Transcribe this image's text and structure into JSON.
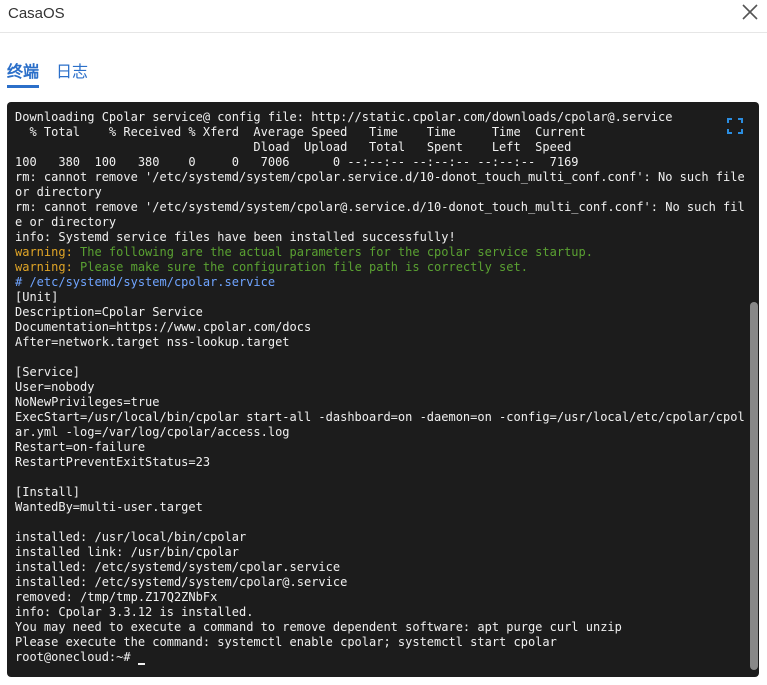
{
  "app": {
    "title": "CasaOS"
  },
  "tabs": [
    {
      "label": "终端"
    },
    {
      "label": "日志"
    }
  ],
  "terminal": {
    "lines": [
      {
        "text": "Downloading Cpolar service@ config file: http://static.cpolar.com/downloads/cpolar@.service"
      },
      {
        "text": "  % Total    % Received % Xferd  Average Speed   Time    Time     Time  Current"
      },
      {
        "text": "                                 Dload  Upload   Total   Spent    Left  Speed"
      },
      {
        "text": "100   380  100   380    0     0   7006      0 --:--:-- --:--:-- --:--:--  7169"
      },
      {
        "text": "rm: cannot remove '/etc/systemd/system/cpolar.service.d/10-donot_touch_multi_conf.conf': No such file or directory"
      },
      {
        "text": "rm: cannot remove '/etc/systemd/system/cpolar@.service.d/10-donot_touch_multi_conf.conf': No such file or directory"
      },
      {
        "text": "info: Systemd service files have been installed successfully!"
      },
      {
        "type": "warning",
        "keyword": "warning:",
        "text": "The following are the actual parameters for the cpolar service startup."
      },
      {
        "type": "warning",
        "keyword": "warning:",
        "text": "Please make sure the configuration file path is correctly set."
      },
      {
        "type": "path",
        "text": "# /etc/systemd/system/cpolar.service"
      },
      {
        "text": "[Unit]"
      },
      {
        "text": "Description=Cpolar Service"
      },
      {
        "text": "Documentation=https://www.cpolar.com/docs"
      },
      {
        "text": "After=network.target nss-lookup.target"
      },
      {
        "text": ""
      },
      {
        "text": "[Service]"
      },
      {
        "text": "User=nobody"
      },
      {
        "text": "NoNewPrivileges=true"
      },
      {
        "text": "ExecStart=/usr/local/bin/cpolar start-all -dashboard=on -daemon=on -config=/usr/local/etc/cpolar/cpolar.yml -log=/var/log/cpolar/access.log"
      },
      {
        "text": "Restart=on-failure"
      },
      {
        "text": "RestartPreventExitStatus=23"
      },
      {
        "text": ""
      },
      {
        "text": "[Install]"
      },
      {
        "text": "WantedBy=multi-user.target"
      },
      {
        "text": ""
      },
      {
        "text": "installed: /usr/local/bin/cpolar"
      },
      {
        "text": "installed link: /usr/bin/cpolar"
      },
      {
        "text": "installed: /etc/systemd/system/cpolar.service"
      },
      {
        "text": "installed: /etc/systemd/system/cpolar@.service"
      },
      {
        "text": "removed: /tmp/tmp.Z17Q2ZNbFx"
      },
      {
        "text": "info: Cpolar 3.3.12 is installed."
      },
      {
        "text": "You may need to execute a command to remove dependent software: apt purge curl unzip"
      },
      {
        "text": "Please execute the command: systemctl enable cpolar; systemctl start cpolar"
      }
    ],
    "prompt": "root@onecloud:~# "
  },
  "colors": {
    "accent": "#2b6fc9",
    "terminal_bg": "#1c1c1c",
    "warning": "#e0a526",
    "warning_message": "#5aa132",
    "path": "#6fa4ff"
  },
  "icons": {
    "close": "close-icon",
    "fullscreen": "fullscreen-icon"
  }
}
